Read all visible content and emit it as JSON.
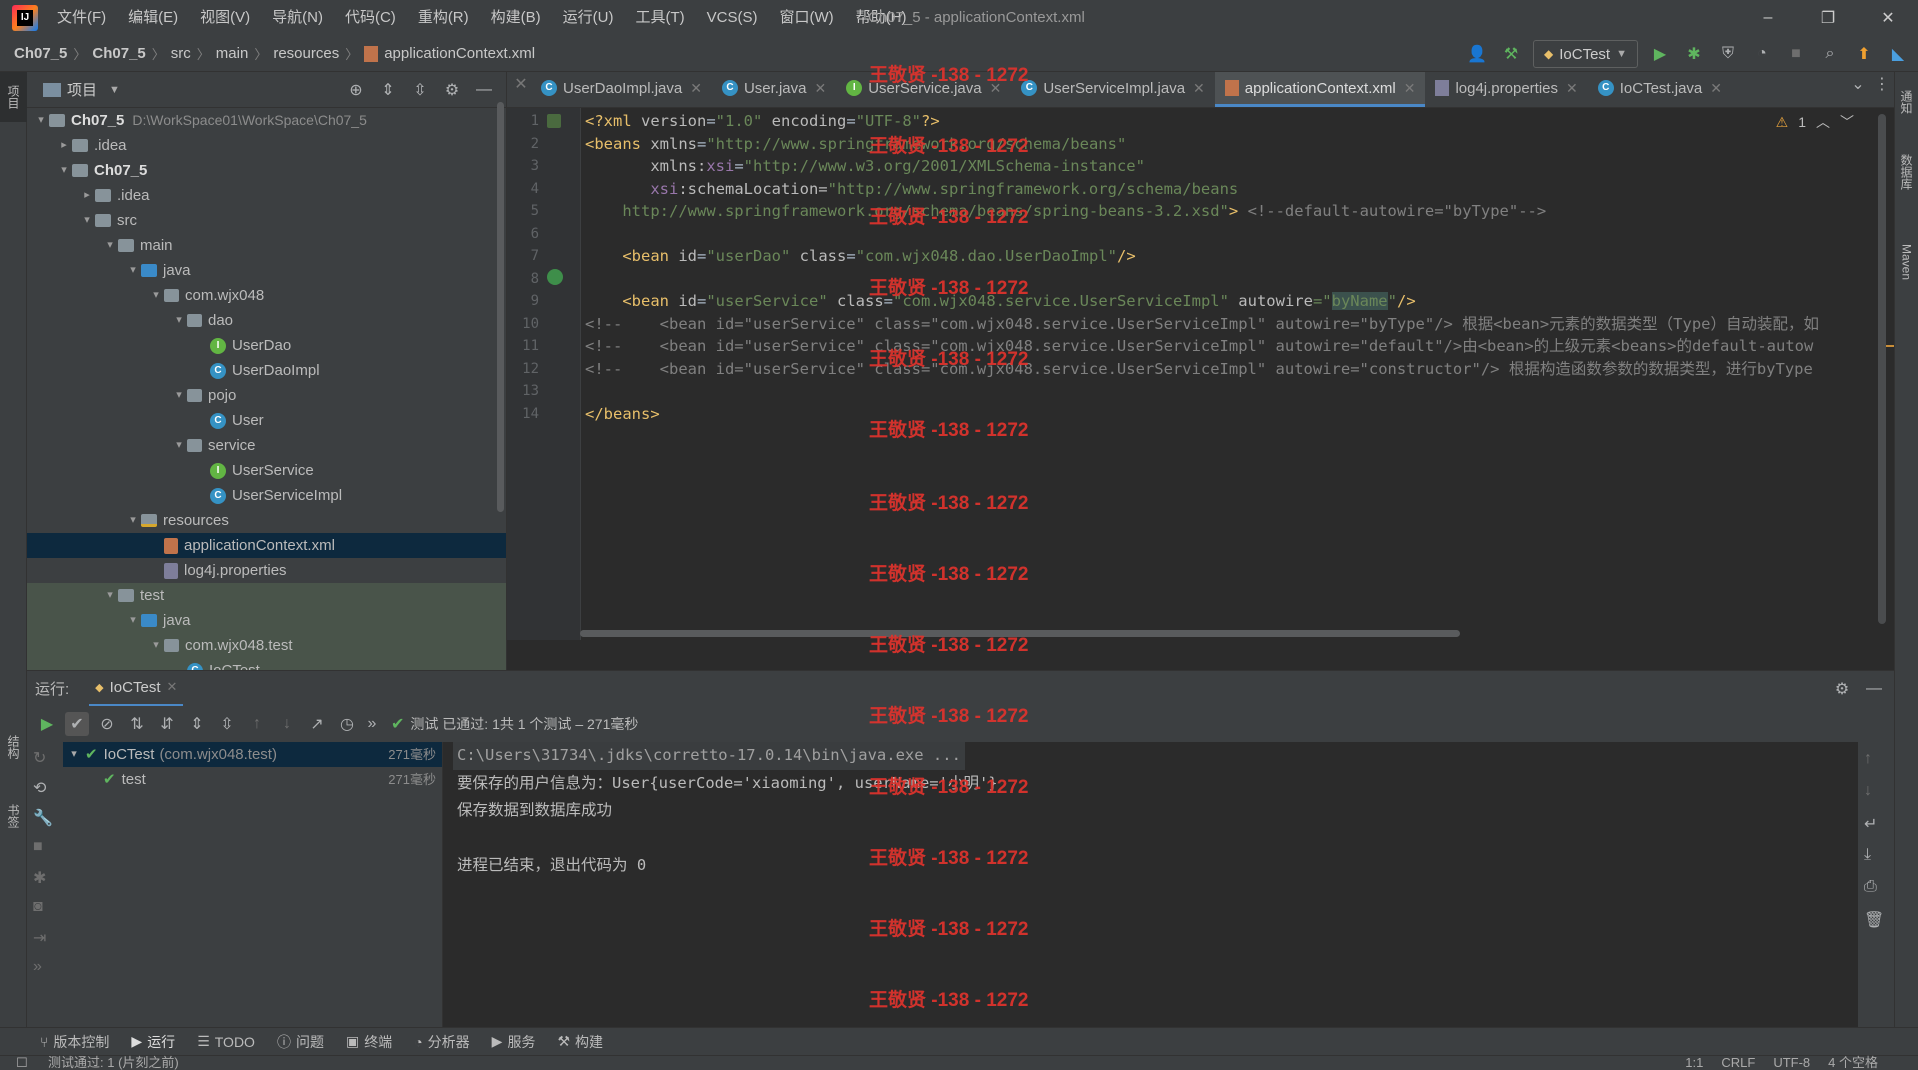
{
  "window": {
    "title": "Ch07_5 - applicationContext.xml"
  },
  "menu": [
    "文件(F)",
    "编辑(E)",
    "视图(V)",
    "导航(N)",
    "代码(C)",
    "重构(R)",
    "构建(B)",
    "运行(U)",
    "工具(T)",
    "VCS(S)",
    "窗口(W)",
    "帮助(H)"
  ],
  "breadcrumb": [
    "Ch07_5",
    "Ch07_5",
    "src",
    "main",
    "resources",
    "applicationContext.xml"
  ],
  "run_config": "IoCTest",
  "left_strip": {
    "project": "项目",
    "structure": "结构",
    "bookmarks": "书签"
  },
  "right_strip": {
    "notify": "通知",
    "database": "数据库",
    "maven": "Maven"
  },
  "project": {
    "title": "项目",
    "tree": [
      {
        "label": "Ch07_5",
        "extra": "D:\\WorkSpace01\\WorkSpace\\Ch07_5",
        "indent": 0,
        "arrow": "▾",
        "icon": "folder",
        "bold": true
      },
      {
        "label": ".idea",
        "indent": 1,
        "arrow": "▸",
        "icon": "folder"
      },
      {
        "label": "Ch07_5",
        "indent": 1,
        "arrow": "▾",
        "icon": "folder",
        "bold": true
      },
      {
        "label": ".idea",
        "indent": 2,
        "arrow": "▸",
        "icon": "folder"
      },
      {
        "label": "src",
        "indent": 2,
        "arrow": "▾",
        "icon": "folder"
      },
      {
        "label": "main",
        "indent": 3,
        "arrow": "▾",
        "icon": "folder"
      },
      {
        "label": "java",
        "indent": 4,
        "arrow": "▾",
        "icon": "folder-blue"
      },
      {
        "label": "com.wjx048",
        "indent": 5,
        "arrow": "▾",
        "icon": "pkg"
      },
      {
        "label": "dao",
        "indent": 6,
        "arrow": "▾",
        "icon": "pkg"
      },
      {
        "label": "UserDao",
        "indent": 7,
        "arrow": "",
        "icon": "i"
      },
      {
        "label": "UserDaoImpl",
        "indent": 7,
        "arrow": "",
        "icon": "c"
      },
      {
        "label": "pojo",
        "indent": 6,
        "arrow": "▾",
        "icon": "pkg"
      },
      {
        "label": "User",
        "indent": 7,
        "arrow": "",
        "icon": "c"
      },
      {
        "label": "service",
        "indent": 6,
        "arrow": "▾",
        "icon": "pkg"
      },
      {
        "label": "UserService",
        "indent": 7,
        "arrow": "",
        "icon": "i"
      },
      {
        "label": "UserServiceImpl",
        "indent": 7,
        "arrow": "",
        "icon": "c"
      },
      {
        "label": "resources",
        "indent": 4,
        "arrow": "▾",
        "icon": "folder-res"
      },
      {
        "label": "applicationContext.xml",
        "indent": 5,
        "arrow": "",
        "icon": "xml",
        "selected": true
      },
      {
        "label": "log4j.properties",
        "indent": 5,
        "arrow": "",
        "icon": "prop"
      },
      {
        "label": "test",
        "indent": 3,
        "arrow": "▾",
        "icon": "folder",
        "test": true
      },
      {
        "label": "java",
        "indent": 4,
        "arrow": "▾",
        "icon": "folder-blue",
        "test": true
      },
      {
        "label": "com.wjx048.test",
        "indent": 5,
        "arrow": "▾",
        "icon": "pkg",
        "test": true
      },
      {
        "label": "IoCTest",
        "indent": 6,
        "arrow": "",
        "icon": "c",
        "test": true
      }
    ]
  },
  "editor_tabs": [
    {
      "label": "UserDaoImpl.java",
      "icon": "c"
    },
    {
      "label": "User.java",
      "icon": "c"
    },
    {
      "label": "UserService.java",
      "icon": "i"
    },
    {
      "label": "UserServiceImpl.java",
      "icon": "c"
    },
    {
      "label": "applicationContext.xml",
      "icon": "xml",
      "active": true
    },
    {
      "label": "log4j.properties",
      "icon": "prop"
    },
    {
      "label": "IoCTest.java",
      "icon": "c"
    }
  ],
  "warnings": "1",
  "code": {
    "line_numbers": [
      "1",
      "2",
      "3",
      "4",
      "5",
      "6",
      "7",
      "8",
      "9",
      "10",
      "11",
      "12",
      "13",
      "14"
    ],
    "l1": {
      "a": "<?xml ",
      "b": "version",
      "c": "=",
      "d": "\"1.0\"",
      "e": " encoding",
      "f": "=",
      "g": "\"UTF-8\"",
      "h": "?>"
    },
    "l2": {
      "a": "<beans ",
      "b": "xmlns",
      "c": "=",
      "d": "\"http://www.springframework.org/schema/beans\""
    },
    "l3": {
      "a": "       xmlns:",
      "b": "xsi",
      "c": "=",
      "d": "\"http://www.w3.org/2001/XMLSchema-instance\""
    },
    "l4": {
      "a": "       ",
      "b": "xsi",
      "c": ":schemaLocation=",
      "d": "\"http://www.springframework.org/schema/beans"
    },
    "l5": {
      "a": "    http://www.springframework.org/schema/beans/spring-beans-3.2.xsd\"",
      "b": ">",
      "c": " <!--default-autowire=\"byType\"-->"
    },
    "l7": {
      "a": "    <bean ",
      "b": "id",
      "c": "=",
      "d": "\"userDao\"",
      "e": " class",
      "f": "=",
      "g": "\"com.wjx048.dao.UserDaoImpl\"",
      "h": "/>"
    },
    "l9": {
      "a": "    <bean ",
      "b": "id",
      "c": "=",
      "d": "\"userService\"",
      "e": " class",
      "f": "=",
      "g": "\"com.wjx048.service.UserServiceImpl\"",
      "h": " autowire",
      "i": "=\"",
      "j": "byName",
      "k": "\"",
      "l": "/>"
    },
    "l10": "<!--    <bean id=\"userService\" class=\"com.wjx048.service.UserServiceImpl\" autowire=\"byType\"/> 根据<bean>元素的数据类型（Type）自动装配，如",
    "l11": "<!--    <bean id=\"userService\" class=\"com.wjx048.service.UserServiceImpl\" autowire=\"default\"/>由<bean>的上级元素<beans>的default-autow",
    "l12": "<!--    <bean id=\"userService\" class=\"com.wjx048.service.UserServiceImpl\" autowire=\"constructor\"/> 根据构造函数参数的数据类型，进行byType",
    "l14": "</beans>"
  },
  "run": {
    "label": "运行:",
    "tab": "IoCTest",
    "status": "测试 已通过: 1共 1 个测试 – 271毫秒",
    "tests": [
      {
        "label": "IoCTest",
        "pkg": "(com.wjx048.test)",
        "time": "271毫秒"
      },
      {
        "label": "test",
        "time": "271毫秒"
      }
    ],
    "console": [
      "C:\\Users\\31734\\.jdks\\corretto-17.0.14\\bin\\java.exe ...",
      "要保存的用户信息为：User{userCode='xiaoming', userName='小明'}",
      "保存数据到数据库成功",
      "",
      "进程已结束，退出代码为 0"
    ]
  },
  "bottom_tools": [
    "版本控制",
    "运行",
    "TODO",
    "问题",
    "终端",
    "分析器",
    "服务",
    "构建"
  ],
  "status": {
    "message": "测试通过: 1 (片刻之前)",
    "pos": "1:1",
    "eol": "CRLF",
    "enc": "UTF-8",
    "indent": "4 个空格"
  },
  "watermark": "王敬贤 -138 - 1272"
}
